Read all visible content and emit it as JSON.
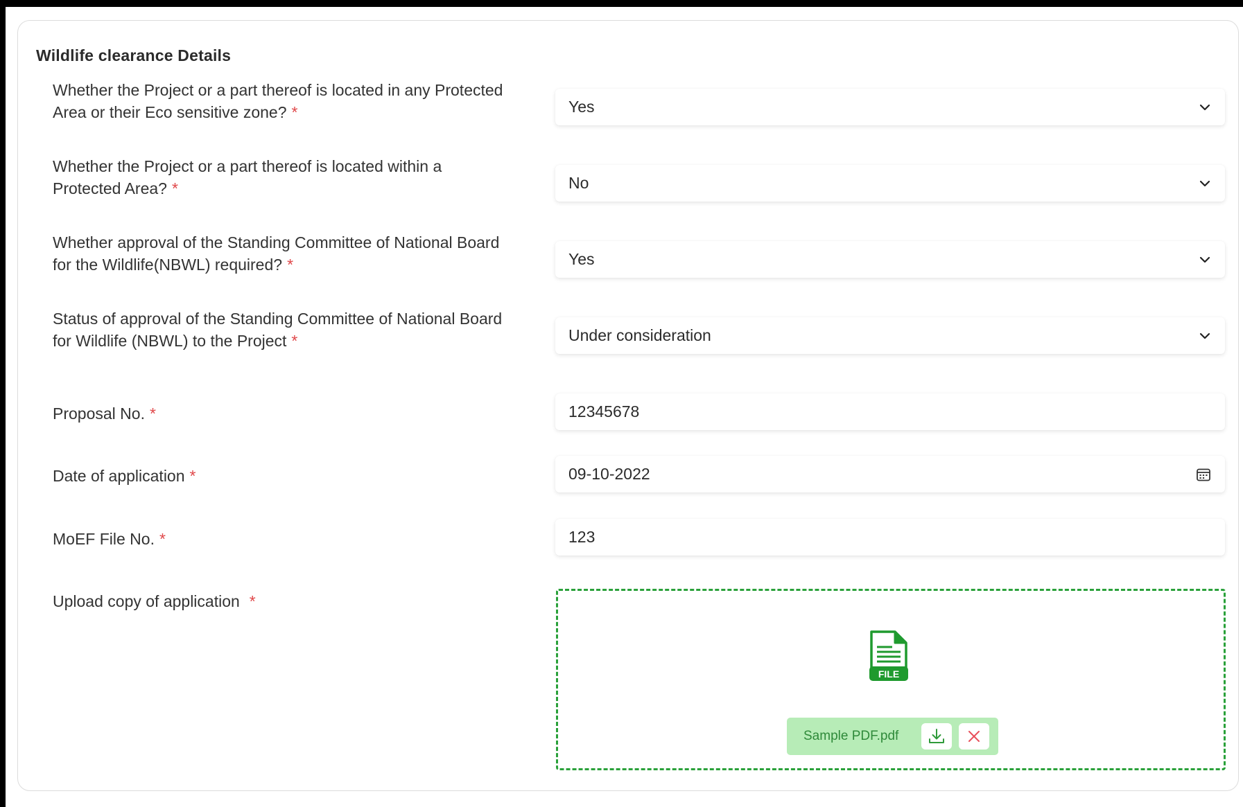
{
  "section": {
    "title": "Wildlife clearance Details"
  },
  "fields": [
    {
      "label": "Whether the Project or a part thereof is located in any Protected Area or their Eco sensitive zone?",
      "value": "Yes"
    },
    {
      "label": "Whether the Project or a part thereof is located within a Protected Area?",
      "value": "No"
    },
    {
      "label": "Whether approval of the Standing Committee of National Board for the Wildlife(NBWL) required?",
      "value": "Yes"
    },
    {
      "label": "Status of approval of the Standing Committee of National Board for Wildlife (NBWL) to the Project",
      "value": "Under consideration"
    },
    {
      "label": "Proposal No.",
      "value": "12345678"
    },
    {
      "label": "Date of application",
      "value": "09-10-2022"
    },
    {
      "label": "MoEF File No.",
      "value": "123"
    },
    {
      "label": "Upload copy of application"
    }
  ],
  "required_marker": "*",
  "upload": {
    "file_icon_text": "FILE",
    "file_name": "Sample PDF.pdf"
  },
  "colors": {
    "required": "#e0484a",
    "dropzone_border": "#2aa13a",
    "file_chip_bg": "#b7ecb7",
    "file_icon": "#1f9a2e",
    "remove_icon": "#e8505b"
  }
}
